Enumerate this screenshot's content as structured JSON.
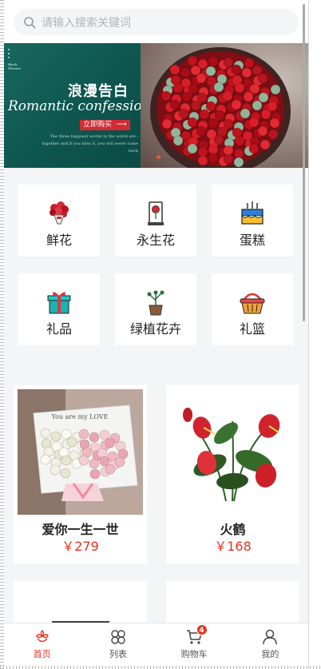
{
  "search": {
    "placeholder": "请输入搜索关键词",
    "icon": "search-icon"
  },
  "banner": {
    "tiny_text": "Black\nFlowers",
    "title": "浪漫告白",
    "subtitle": "Romantic confession",
    "button_label": "立即购买",
    "small_copy": "The three happiest words in the world are : together and if you miss it, you will never come back",
    "active_dot_color": "#e8563d"
  },
  "categories": [
    {
      "label": "鲜花",
      "icon": "bouquet-icon"
    },
    {
      "label": "永生花",
      "icon": "preserved-flower-icon"
    },
    {
      "label": "蛋糕",
      "icon": "cake-icon"
    },
    {
      "label": "礼品",
      "icon": "gift-icon"
    },
    {
      "label": "绿植花卉",
      "icon": "potted-plant-icon"
    },
    {
      "label": "礼篮",
      "icon": "basket-icon"
    }
  ],
  "products": [
    {
      "name": "爱你一生一世",
      "price": "￥279",
      "image": "rose-bouquet-photo",
      "wrap_text": "You are my LOVE"
    },
    {
      "name": "火鹤",
      "price": "￥168",
      "image": "anthurium-photo"
    },
    {
      "name": "",
      "price": ""
    },
    {
      "name": "",
      "price": ""
    }
  ],
  "tabbar": {
    "items": [
      {
        "label": "首页",
        "icon": "home-flower-icon",
        "active": true
      },
      {
        "label": "列表",
        "icon": "grid-clover-icon",
        "active": false
      },
      {
        "label": "购物车",
        "icon": "cart-icon",
        "active": false,
        "badge": "4"
      },
      {
        "label": "我的",
        "icon": "user-icon",
        "active": false
      }
    ]
  },
  "colors": {
    "accent": "#e5331f",
    "background": "#f4f5f7",
    "banner_green": "#0e564f"
  }
}
